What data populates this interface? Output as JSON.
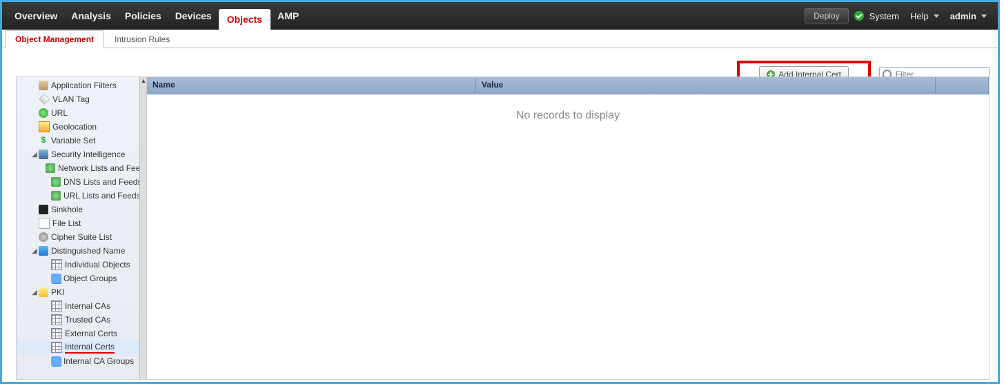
{
  "topnav": {
    "tabs": [
      "Overview",
      "Analysis",
      "Policies",
      "Devices",
      "Objects",
      "AMP"
    ],
    "active": "Objects",
    "deploy": "Deploy",
    "system": "System",
    "help": "Help",
    "user": "admin"
  },
  "subtabs": {
    "items": [
      "Object Management",
      "Intrusion Rules"
    ],
    "active": "Object Management"
  },
  "toolbar": {
    "add_label": "Add Internal Cert",
    "filter_placeholder": "Filter"
  },
  "grid": {
    "columns": {
      "name": "Name",
      "value": "Value"
    },
    "empty": "No records to display"
  },
  "tree": [
    {
      "l": 1,
      "icon": "i-app",
      "label": "Application Filters"
    },
    {
      "l": 1,
      "icon": "i-tag",
      "label": "VLAN Tag"
    },
    {
      "l": 1,
      "icon": "i-url",
      "label": "URL"
    },
    {
      "l": 1,
      "icon": "i-geo",
      "label": "Geolocation"
    },
    {
      "l": 1,
      "icon": "i-var",
      "label": "Variable Set"
    },
    {
      "l": 1,
      "icon": "i-si",
      "label": "Security Intelligence",
      "exp": true
    },
    {
      "l": 2,
      "icon": "i-feed",
      "label": "Network Lists and Feeds"
    },
    {
      "l": 2,
      "icon": "i-feed",
      "label": "DNS Lists and Feeds"
    },
    {
      "l": 2,
      "icon": "i-feed",
      "label": "URL Lists and Feeds"
    },
    {
      "l": 1,
      "icon": "i-sink",
      "label": "Sinkhole"
    },
    {
      "l": 1,
      "icon": "i-file",
      "label": "File List"
    },
    {
      "l": 1,
      "icon": "i-cipher",
      "label": "Cipher Suite List"
    },
    {
      "l": 1,
      "icon": "i-dn",
      "label": "Distinguished Name",
      "exp": true
    },
    {
      "l": 2,
      "icon": "i-grid",
      "label": "Individual Objects"
    },
    {
      "l": 2,
      "icon": "i-group",
      "label": "Object Groups"
    },
    {
      "l": 1,
      "icon": "i-key",
      "label": "PKI",
      "exp": true
    },
    {
      "l": 2,
      "icon": "i-grid",
      "label": "Internal CAs"
    },
    {
      "l": 2,
      "icon": "i-grid",
      "label": "Trusted CAs"
    },
    {
      "l": 2,
      "icon": "i-grid",
      "label": "External Certs"
    },
    {
      "l": 2,
      "icon": "i-grid",
      "label": "Internal Certs",
      "sel": true,
      "ul": true
    },
    {
      "l": 2,
      "icon": "i-group",
      "label": "Internal CA Groups"
    }
  ]
}
